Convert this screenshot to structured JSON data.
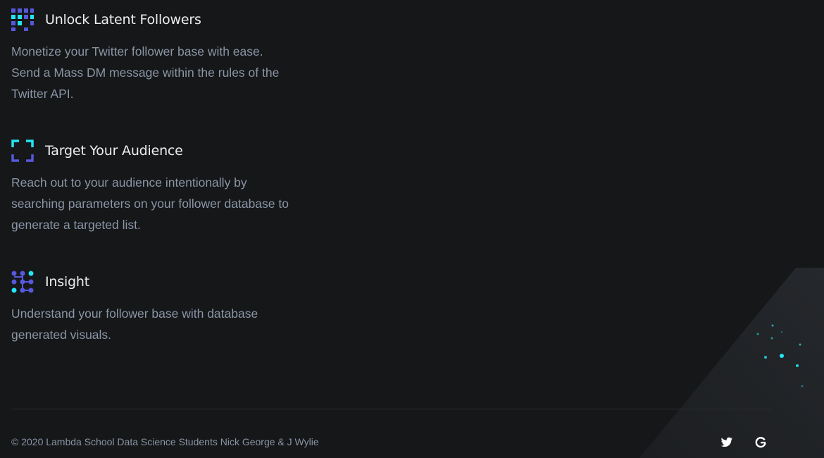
{
  "features": [
    {
      "icon": "grid-squares-icon",
      "title": "Unlock Latent Followers",
      "description": "Monetize your Twitter follower base with ease. Send a Mass DM message within the rules of the Twitter API."
    },
    {
      "icon": "target-frame-icon",
      "title": "Target Your Audience",
      "description": "Reach out to your audience intentionally by searching parameters on your follower database to generate a targeted list."
    },
    {
      "icon": "connected-dots-icon",
      "title": "Insight",
      "description": "Understand your follower base with database generated visuals."
    }
  ],
  "footer": {
    "copyright": "© 2020 Lambda School Data Science Students Nick George & J Wylie",
    "social": [
      {
        "icon": "twitter-icon"
      },
      {
        "icon": "google-icon"
      }
    ]
  },
  "colors": {
    "background": "#151719",
    "title": "#eceded",
    "body_text": "#8a95a5",
    "accent_blue": "#5658dd",
    "accent_cyan": "#24e5f2"
  }
}
